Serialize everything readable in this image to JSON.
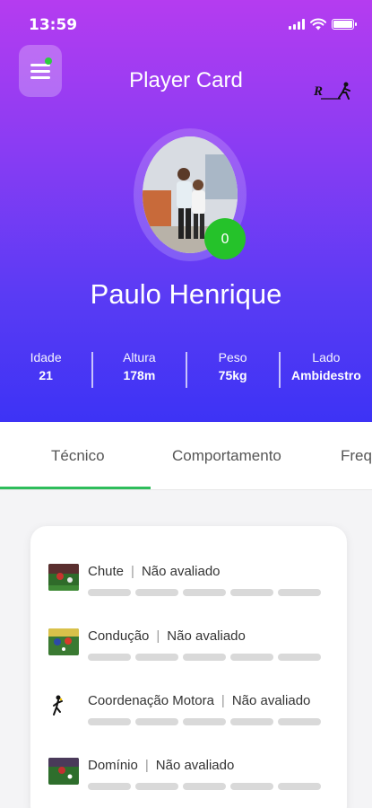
{
  "status_bar": {
    "time": "13:59"
  },
  "header": {
    "title": "Player Card",
    "brand_logo_text": "R"
  },
  "player": {
    "name": "Paulo Henrique",
    "score": "0",
    "stats": [
      {
        "label": "Idade",
        "value": "21"
      },
      {
        "label": "Altura",
        "value": "178m"
      },
      {
        "label": "Peso",
        "value": "75kg"
      },
      {
        "label": "Lado",
        "value": "Ambidestro"
      }
    ]
  },
  "tabs": [
    {
      "label": "Técnico",
      "active": true
    },
    {
      "label": "Comportamento",
      "active": false
    },
    {
      "label": "Frequ",
      "active": false
    }
  ],
  "skills": [
    {
      "name": "Chute",
      "status": "Não avaliado",
      "thumb": "soccer-photo-icon"
    },
    {
      "name": "Condução",
      "status": "Não avaliado",
      "thumb": "soccer-photo-icon"
    },
    {
      "name": "Coordenação Motora",
      "status": "Não avaliado",
      "thumb": "running-figure-icon"
    },
    {
      "name": "Domínio",
      "status": "Não avaliado",
      "thumb": "soccer-photo-icon"
    }
  ],
  "colors": {
    "accent_green": "#2ebd5b",
    "badge_green": "#25c22a",
    "gradient_top": "#b53cf0",
    "gradient_bottom": "#3d33f5"
  }
}
